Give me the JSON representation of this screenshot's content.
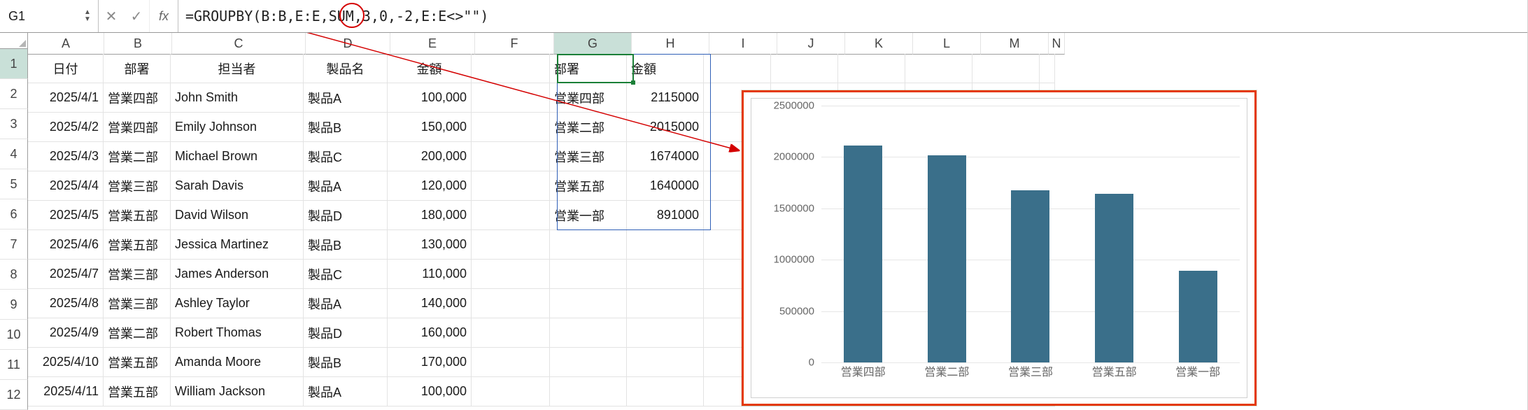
{
  "name_box": "G1",
  "formula": "=GROUPBY(B:B,E:E,SUM,3,0,-2,E:E<>\"\")",
  "columns": [
    "A",
    "B",
    "C",
    "D",
    "E",
    "F",
    "G",
    "H",
    "I",
    "J",
    "K",
    "L",
    "M",
    "N"
  ],
  "row_numbers": [
    1,
    2,
    3,
    4,
    5,
    6,
    7,
    8,
    9,
    10,
    11,
    12
  ],
  "headers": {
    "A": "日付",
    "B": "部署",
    "C": "担当者",
    "D": "製品名",
    "E": "金額"
  },
  "data": [
    {
      "A": "2025/4/1",
      "B": "営業四部",
      "C": "John Smith",
      "D": "製品A",
      "E": "100,000"
    },
    {
      "A": "2025/4/2",
      "B": "営業四部",
      "C": "Emily Johnson",
      "D": "製品B",
      "E": "150,000"
    },
    {
      "A": "2025/4/3",
      "B": "営業二部",
      "C": "Michael Brown",
      "D": "製品C",
      "E": "200,000"
    },
    {
      "A": "2025/4/4",
      "B": "営業三部",
      "C": "Sarah Davis",
      "D": "製品A",
      "E": "120,000"
    },
    {
      "A": "2025/4/5",
      "B": "営業五部",
      "C": "David Wilson",
      "D": "製品D",
      "E": "180,000"
    },
    {
      "A": "2025/4/6",
      "B": "営業五部",
      "C": "Jessica Martinez",
      "D": "製品B",
      "E": "130,000"
    },
    {
      "A": "2025/4/7",
      "B": "営業三部",
      "C": "James Anderson",
      "D": "製品C",
      "E": "110,000"
    },
    {
      "A": "2025/4/8",
      "B": "営業三部",
      "C": "Ashley Taylor",
      "D": "製品A",
      "E": "140,000"
    },
    {
      "A": "2025/4/9",
      "B": "営業二部",
      "C": "Robert Thomas",
      "D": "製品D",
      "E": "160,000"
    },
    {
      "A": "2025/4/10",
      "B": "営業五部",
      "C": "Amanda Moore",
      "D": "製品B",
      "E": "170,000"
    },
    {
      "A": "2025/4/11",
      "B": "営業五部",
      "C": "William Jackson",
      "D": "製品A",
      "E": "100,000"
    }
  ],
  "group_headers": {
    "G": "部署",
    "H": "金額"
  },
  "group_data": [
    {
      "G": "営業四部",
      "H": "2115000"
    },
    {
      "G": "営業二部",
      "H": "2015000"
    },
    {
      "G": "営業三部",
      "H": "1674000"
    },
    {
      "G": "営業五部",
      "H": "1640000"
    },
    {
      "G": "営業一部",
      "H": "891000"
    }
  ],
  "chart_data": {
    "type": "bar",
    "categories": [
      "営業四部",
      "営業二部",
      "営業三部",
      "営業五部",
      "営業一部"
    ],
    "values": [
      2115000,
      2015000,
      1674000,
      1640000,
      891000
    ],
    "ylim": [
      0,
      2500000
    ],
    "yticks": [
      0,
      500000,
      1000000,
      1500000,
      2000000,
      2500000
    ],
    "title": "",
    "xlabel": "",
    "ylabel": ""
  }
}
